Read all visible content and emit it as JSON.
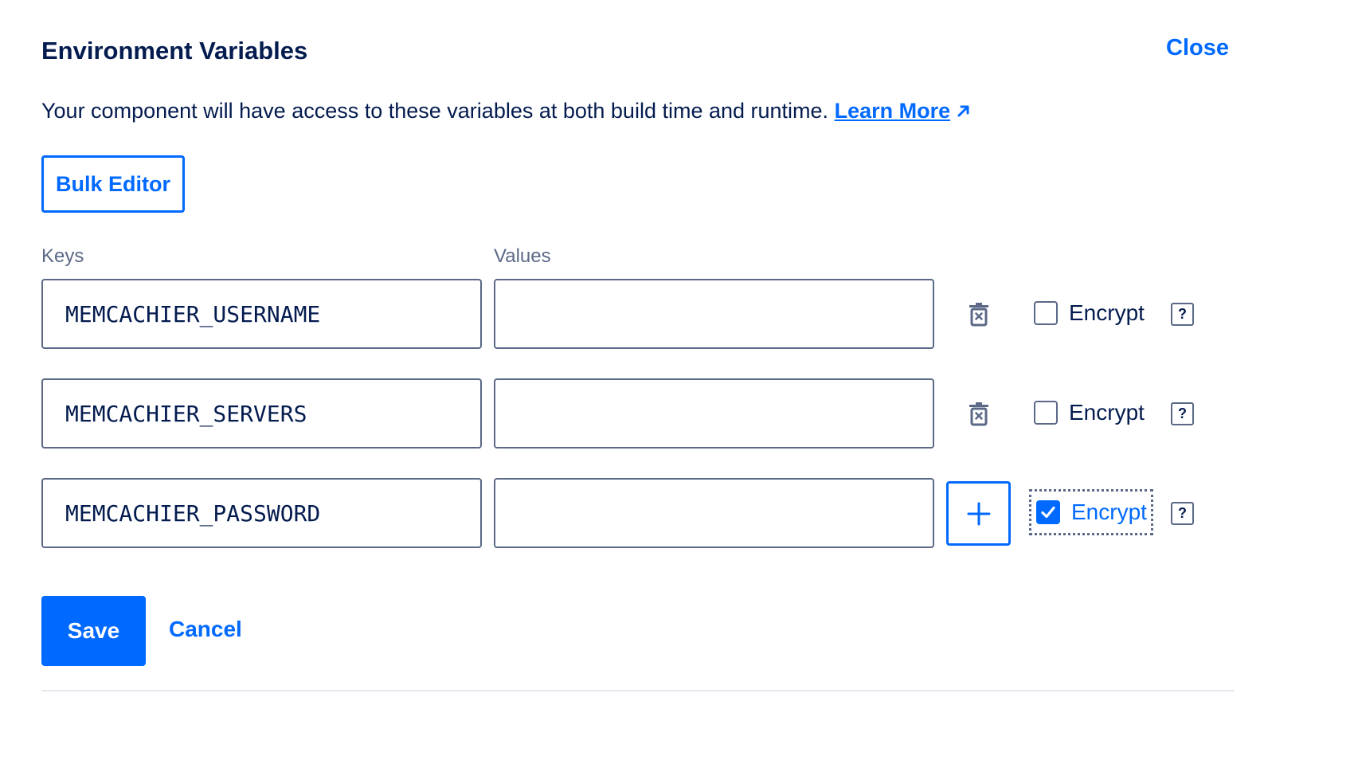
{
  "header": {
    "title": "Environment Variables",
    "close_label": "Close"
  },
  "description": {
    "text": "Your component will have access to these variables at both build time and runtime.",
    "link_label": "Learn More"
  },
  "bulk_editor_label": "Bulk Editor",
  "columns": {
    "keys_label": "Keys",
    "values_label": "Values"
  },
  "rows": [
    {
      "key": "MEMCACHIER_USERNAME",
      "value": "",
      "encrypt_label": "Encrypt",
      "encrypted": false,
      "action": "delete",
      "help": "?"
    },
    {
      "key": "MEMCACHIER_SERVERS",
      "value": "",
      "encrypt_label": "Encrypt",
      "encrypted": false,
      "action": "delete",
      "help": "?"
    },
    {
      "key": "MEMCACHIER_PASSWORD",
      "value": "",
      "encrypt_label": "Encrypt",
      "encrypted": true,
      "action": "add",
      "help": "?"
    }
  ],
  "footer": {
    "save_label": "Save",
    "cancel_label": "Cancel"
  },
  "icons": {
    "delete": "trash-icon",
    "add": "plus-icon",
    "external": "external-link-arrow-icon",
    "check": "checkmark-icon"
  },
  "colors": {
    "accent": "#0069ff",
    "text": "#031b4e",
    "muted": "#5b6987"
  }
}
